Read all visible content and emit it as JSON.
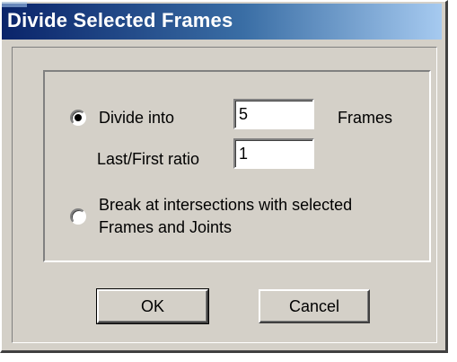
{
  "dialog": {
    "title": "Divide Selected Frames"
  },
  "divide_option": {
    "label": "Divide into",
    "selected": true,
    "count_value": "5",
    "count_unit": "Frames",
    "ratio_label": "Last/First ratio",
    "ratio_value": "1"
  },
  "break_option": {
    "label_line1": "Break at intersections with selected",
    "label_line2": "Frames and Joints",
    "selected": false
  },
  "buttons": {
    "ok_label": "OK",
    "cancel_label": "Cancel"
  },
  "colors": {
    "face": "#d4d0c8",
    "title_start": "#0a246a",
    "title_end": "#a6caf0"
  }
}
